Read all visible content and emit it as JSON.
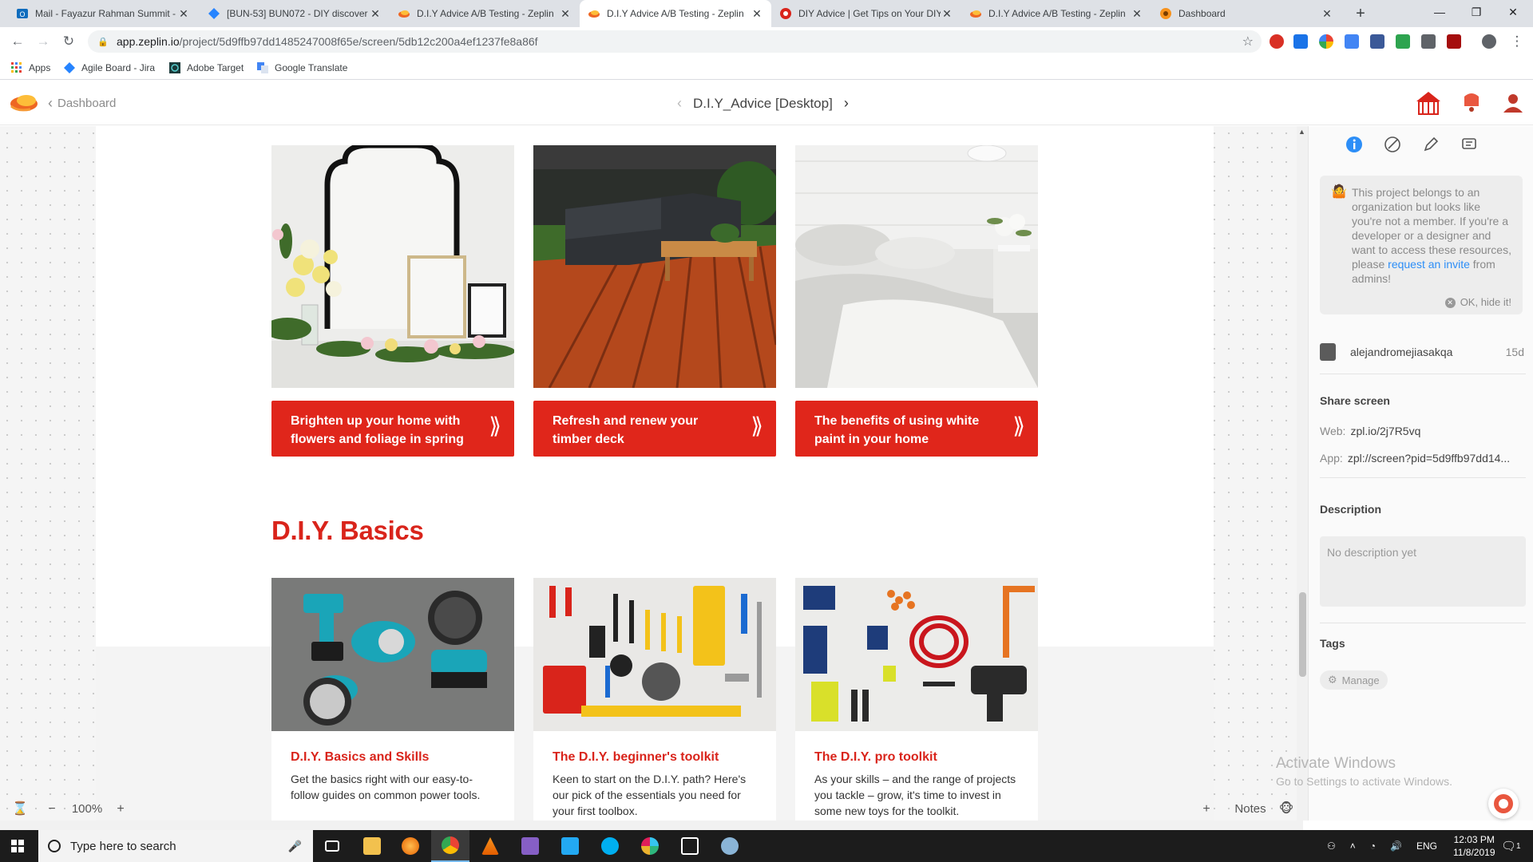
{
  "browser": {
    "tabs": [
      {
        "title": "Mail - Fayazur Rahman Summit -",
        "icon": "outlook-icon",
        "color": "#0f6cbd",
        "active": false
      },
      {
        "title": "[BUN-53] BUN072 - DIY discover",
        "icon": "jira-icon",
        "color": "#2684ff",
        "active": false
      },
      {
        "title": "D.I.Y Advice A/B Testing - Zeplin",
        "icon": "zeplin-icon",
        "color": "#ee6723",
        "active": false
      },
      {
        "title": "D.I.Y Advice A/B Testing - Zeplin",
        "icon": "zeplin-icon",
        "color": "#ee6723",
        "active": true
      },
      {
        "title": "DIY Advice | Get Tips on Your DIY",
        "icon": "bunnings-icon",
        "color": "#d9241b",
        "active": false
      },
      {
        "title": "D.I.Y Advice A/B Testing - Zeplin",
        "icon": "zeplin-icon",
        "color": "#ee6723",
        "active": false
      },
      {
        "title": "Dashboard",
        "icon": "zeplin-dashboard-icon",
        "color": "#f7931e",
        "active": false
      }
    ],
    "url_host": "app.zeplin.io",
    "url_path": "/project/5d9ffb97dd1485247008f65e/screen/5db12c200a4ef1237fe8a86f",
    "bookmarks": [
      {
        "label": "Apps",
        "icon": "apps-grid-icon"
      },
      {
        "label": "Agile Board - Jira",
        "icon": "jira-icon"
      },
      {
        "label": "Adobe Target",
        "icon": "adobe-target-icon"
      },
      {
        "label": "Google Translate",
        "icon": "google-translate-icon"
      }
    ]
  },
  "zeplin": {
    "back_label": "Dashboard",
    "screen_title": "D.I.Y_Advice [Desktop]",
    "zoom": "100%",
    "notes_label": "Notes"
  },
  "artboard": {
    "ctas": [
      {
        "text": "Brighten up your home with flowers and foliage in spring",
        "chevron": "⟫"
      },
      {
        "text": "Refresh and renew your timber deck",
        "chevron": "⟫"
      },
      {
        "text": "The benefits of using white paint in your home",
        "chevron": "⟫"
      }
    ],
    "section_title": "D.I.Y. Basics",
    "cards": [
      {
        "title": "D.I.Y. Basics and Skills",
        "desc": "Get the basics right with our easy-to-follow guides on common power tools."
      },
      {
        "title": "The D.I.Y. beginner's toolkit",
        "desc": "Keen to start on the D.I.Y. path? Here's our pick of the essentials you need for your first toolbox."
      },
      {
        "title": "The D.I.Y. pro toolkit",
        "desc": "As your skills – and the range of projects you tackle – grow, it's time to invest in some new toys for the toolkit."
      }
    ],
    "brand_red": "#e0261b"
  },
  "panel": {
    "notice_pre": "This project belongs to an organization but looks like you're not a member. If you're a developer or a designer and want to access these resources, please ",
    "notice_link": "request an invite",
    "notice_post": " from admins!",
    "hide_label": "OK, hide it!",
    "owner": "alejandromejiasakqa",
    "owner_age": "15d",
    "share_heading": "Share screen",
    "web_label": "Web:",
    "web_value": "zpl.io/2j7R5vq",
    "app_label": "App:",
    "app_value": "zpl://screen?pid=5d9ffb97dd14...",
    "description_heading": "Description",
    "description_placeholder": "No description yet",
    "tags_heading": "Tags",
    "manage_label": "Manage"
  },
  "windows": {
    "activate_title": "Activate Windows",
    "activate_sub": "Go to Settings to activate Windows.",
    "search_placeholder": "Type here to search",
    "lang": "ENG",
    "time": "12:03 PM",
    "date": "11/8/2019",
    "notification_count": "1"
  }
}
